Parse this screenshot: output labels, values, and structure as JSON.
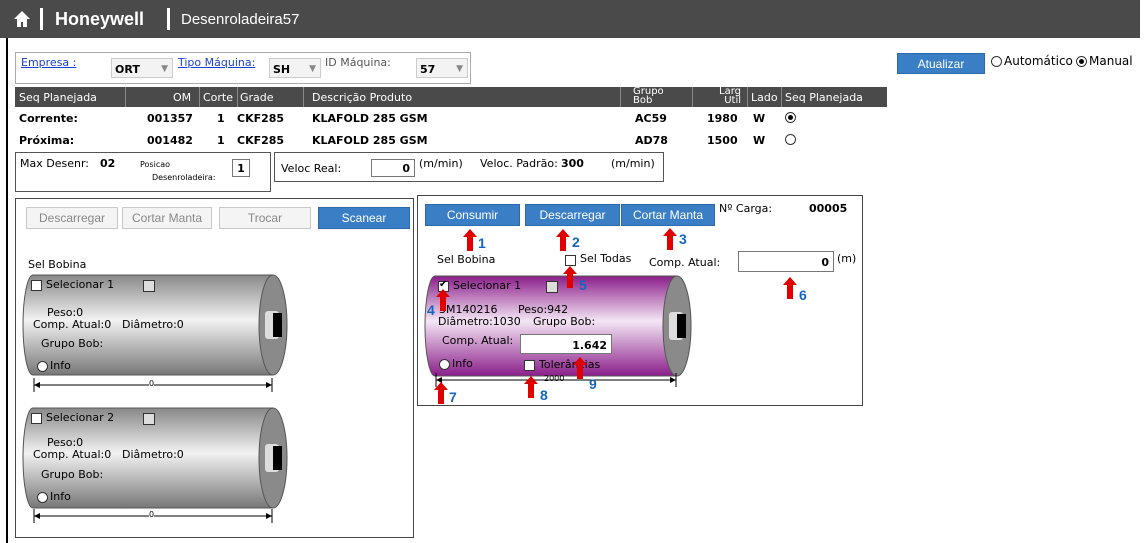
{
  "header": {
    "brand": "Honeywell",
    "page_title": "Desenroladeira57"
  },
  "filters": {
    "empresa_label": "Empresa :",
    "empresa_value": "ORT",
    "tipo_label": "Tipo Máquina:",
    "tipo_value": "SH",
    "id_label": "ID Máquina:",
    "id_value": "57"
  },
  "controls": {
    "atualizar": "Atualizar",
    "automatico": "Automático",
    "manual": "Manual"
  },
  "table": {
    "headers": [
      "Seq Planejada",
      "OM",
      "Corte",
      "Grade",
      "Descrição Produto",
      "Grupo Bob",
      "Larg Util",
      "Lado",
      "Seq Planejada"
    ],
    "rows": [
      {
        "label": "Corrente:",
        "om": "001357",
        "corte": "1",
        "grade": "CKF285",
        "desc": "KLAFOLD 285 GSM",
        "grupo": "AC59",
        "larg": "1980",
        "lado": "W",
        "selected": true
      },
      {
        "label": "Próxima:",
        "om": "001482",
        "corte": "1",
        "grade": "CKF285",
        "desc": "KLAFOLD 285 GSM",
        "grupo": "AD78",
        "larg": "1500",
        "lado": "W",
        "selected": false
      }
    ]
  },
  "info": {
    "max_desenr_label": "Max Desenr:",
    "max_desenr_value": "02",
    "posicao_label1": "Posicao",
    "posicao_label2": "Desenroladeira:",
    "posicao_value": "1",
    "veloc_real_label": "Veloc Real:",
    "veloc_real_value": "0",
    "veloc_unit": "(m/min)",
    "veloc_padrao_label": "Veloc. Padrão:",
    "veloc_padrao_value": "300",
    "veloc_padrao_unit": "(m/min)"
  },
  "left_panel": {
    "buttons": [
      "Descarregar",
      "Cortar Manta",
      "Trocar",
      "Scanear"
    ],
    "sel_bobina": "Sel Bobina",
    "rolls": [
      {
        "select": "Selecionar 1",
        "peso": "Peso:0",
        "comp": "Comp. Atual:0",
        "diam": "Diâmetro:0",
        "grupo": "Grupo Bob:",
        "info": "Info",
        "width": "0"
      },
      {
        "select": "Selecionar 2",
        "peso": "Peso:0",
        "comp": "Comp. Atual:0",
        "diam": "Diâmetro:0",
        "grupo": "Grupo Bob:",
        "info": "Info",
        "width": "0"
      }
    ]
  },
  "right_panel": {
    "buttons": [
      "Consumir",
      "Descarregar",
      "Cortar Manta"
    ],
    "carga_label": "Nº Carga:",
    "carga_value": "00005",
    "sel_bobina": "Sel Bobina",
    "sel_todas": "Sel Todas",
    "comp_atual_label": "Comp. Atual:",
    "comp_atual_value": "0",
    "comp_unit": "(m)",
    "roll": {
      "select": "Selecionar 1",
      "code": "3M140216",
      "peso": "Peso:942",
      "diam": "Diâmetro:1030",
      "grupo": "Grupo Bob:",
      "comp_label": "Comp. Atual:",
      "comp_value": "1.642",
      "info": "Info",
      "tolerancias": "Tolerâncias",
      "width": "2000"
    }
  },
  "annotations": [
    "1",
    "2",
    "3",
    "4",
    "5",
    "6",
    "7",
    "8",
    "9"
  ],
  "colors": {
    "topbar": "#4a4a4a",
    "button_blue": "#3a7fc6",
    "roll_purple": "#9c2a9c",
    "annotation_arrow": "#e00000",
    "annotation_number": "#1565c0"
  }
}
